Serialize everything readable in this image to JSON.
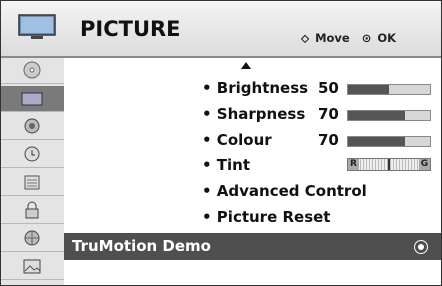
{
  "header": {
    "title": "PICTURE",
    "move_label": "Move",
    "ok_label": "OK"
  },
  "settings": [
    {
      "label": "• Brightness",
      "value": "50",
      "level": 0.5
    },
    {
      "label": "• Sharpness",
      "value": "70",
      "level": 0.7
    },
    {
      "label": "• Colour",
      "value": "70",
      "level": 0.7
    },
    {
      "label": "• Tint",
      "left": "R",
      "right": "G"
    },
    {
      "label": "• Advanced Control"
    },
    {
      "label": "• Picture Reset"
    }
  ],
  "selected_item": {
    "label": "TruMotion Demo"
  },
  "sidebar": {
    "items": [
      {
        "icon": "cd-icon"
      },
      {
        "icon": "tv-picture-icon",
        "active": true
      },
      {
        "icon": "speaker-icon"
      },
      {
        "icon": "clock-icon"
      },
      {
        "icon": "calendar-icon"
      },
      {
        "icon": "lock-icon"
      },
      {
        "icon": "globe-icon"
      },
      {
        "icon": "photo-icon"
      }
    ]
  },
  "colors": {
    "selected_bg": "#4f4f4f",
    "active_sidebar": "#7a7a7a",
    "bar_fill": "#555555"
  }
}
